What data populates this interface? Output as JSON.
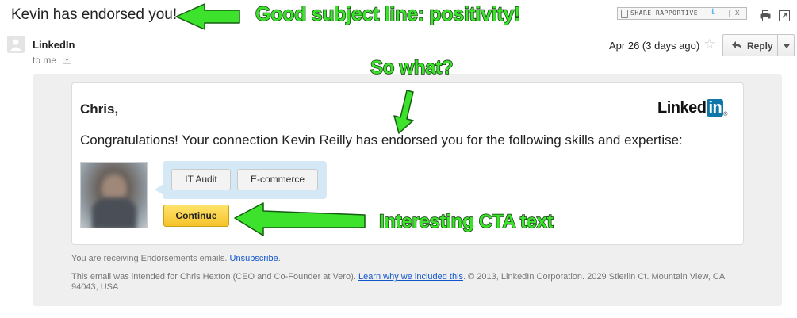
{
  "email": {
    "subject": "Kevin has endorsed you!",
    "sender": "LinkedIn",
    "recipient_label": "to me",
    "date": "Apr 26 (3 days ago)",
    "reply_label": "Reply"
  },
  "toolbar": {
    "rapportive_label": "SHARE RAPPORTIVE",
    "rapportive_t": "t",
    "rapportive_close": "x"
  },
  "message": {
    "greeting": "Chris,",
    "logo_text": "Linked",
    "logo_box_text": "in",
    "logo_reg": "®",
    "body": "Congratulations! Your connection Kevin Reilly has endorsed you for the following skills and expertise:",
    "skills": [
      "IT Audit",
      "E-commerce"
    ],
    "cta_label": "Continue"
  },
  "footer": {
    "receiving_text": "You are receiving Endorsements emails.",
    "unsubscribe_link": "Unsubscribe",
    "unsubscribe_suffix": ".",
    "intended_text": "This email was intended for Chris Hexton (CEO and Co-Founder at Vero).",
    "learn_link": "Learn why we included this",
    "copyright_text": ". © 2013, LinkedIn Corporation. 2029 Stierlin Ct. Mountain View, CA 94043, USA"
  },
  "annotations": {
    "subject_note": "Good subject line: positivity!",
    "so_what_note": "So what?",
    "cta_note": "Interesting CTA text"
  },
  "colors": {
    "annotation_green": "#3ce22b",
    "linkedin_blue": "#0e76a8",
    "cta_yellow": "#f6c32a",
    "link_blue": "#1155cc"
  },
  "icons": {
    "print": "printer-icon",
    "popout": "new-window-icon",
    "star": "star-icon",
    "reply": "reply-arrow-icon"
  }
}
